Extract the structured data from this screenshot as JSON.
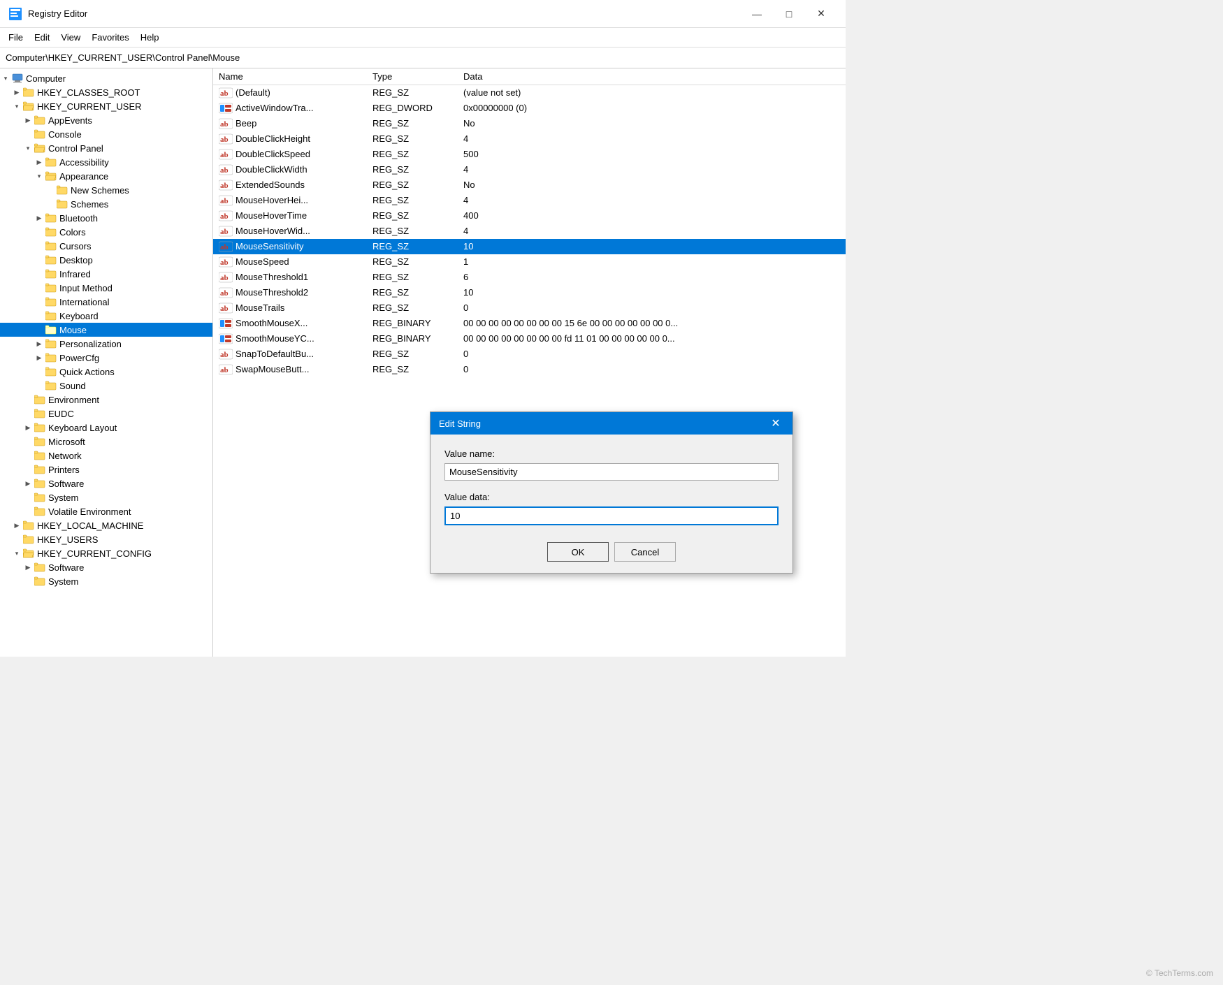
{
  "window": {
    "title": "Registry Editor",
    "icon": "registry-editor-icon"
  },
  "title_controls": {
    "minimize": "—",
    "maximize": "□",
    "close": "✕"
  },
  "menu": {
    "items": [
      "File",
      "Edit",
      "View",
      "Favorites",
      "Help"
    ]
  },
  "address_bar": {
    "path": "Computer\\HKEY_CURRENT_USER\\Control Panel\\Mouse"
  },
  "tree": {
    "items": [
      {
        "id": "computer",
        "label": "Computer",
        "indent": 0,
        "expanded": true,
        "type": "computer",
        "expander": "▾"
      },
      {
        "id": "hkey-classes-root",
        "label": "HKEY_CLASSES_ROOT",
        "indent": 1,
        "expanded": false,
        "type": "folder-closed",
        "expander": "▶"
      },
      {
        "id": "hkey-current-user",
        "label": "HKEY_CURRENT_USER",
        "indent": 1,
        "expanded": true,
        "type": "folder-open",
        "expander": "▾"
      },
      {
        "id": "app-events",
        "label": "AppEvents",
        "indent": 2,
        "expanded": false,
        "type": "folder-closed",
        "expander": "▶"
      },
      {
        "id": "console",
        "label": "Console",
        "indent": 2,
        "expanded": false,
        "type": "folder-closed",
        "expander": ""
      },
      {
        "id": "control-panel",
        "label": "Control Panel",
        "indent": 2,
        "expanded": true,
        "type": "folder-open",
        "expander": "▾"
      },
      {
        "id": "accessibility",
        "label": "Accessibility",
        "indent": 3,
        "expanded": false,
        "type": "folder-closed",
        "expander": "▶"
      },
      {
        "id": "appearance",
        "label": "Appearance",
        "indent": 3,
        "expanded": true,
        "type": "folder-open",
        "expander": "▾"
      },
      {
        "id": "new-schemes",
        "label": "New Schemes",
        "indent": 4,
        "expanded": false,
        "type": "folder-yellow",
        "expander": ""
      },
      {
        "id": "schemes",
        "label": "Schemes",
        "indent": 4,
        "expanded": false,
        "type": "folder-yellow",
        "expander": ""
      },
      {
        "id": "bluetooth",
        "label": "Bluetooth",
        "indent": 3,
        "expanded": false,
        "type": "folder-closed",
        "expander": "▶"
      },
      {
        "id": "colors",
        "label": "Colors",
        "indent": 3,
        "expanded": false,
        "type": "folder-closed",
        "expander": ""
      },
      {
        "id": "cursors",
        "label": "Cursors",
        "indent": 3,
        "expanded": false,
        "type": "folder-closed",
        "expander": ""
      },
      {
        "id": "desktop",
        "label": "Desktop",
        "indent": 3,
        "expanded": false,
        "type": "folder-closed",
        "expander": ""
      },
      {
        "id": "infrared",
        "label": "Infrared",
        "indent": 3,
        "expanded": false,
        "type": "folder-closed",
        "expander": ""
      },
      {
        "id": "input-method",
        "label": "Input Method",
        "indent": 3,
        "expanded": false,
        "type": "folder-closed",
        "expander": ""
      },
      {
        "id": "international",
        "label": "International",
        "indent": 3,
        "expanded": false,
        "type": "folder-closed",
        "expander": ""
      },
      {
        "id": "keyboard",
        "label": "Keyboard",
        "indent": 3,
        "expanded": false,
        "type": "folder-closed",
        "expander": ""
      },
      {
        "id": "mouse",
        "label": "Mouse",
        "indent": 3,
        "expanded": false,
        "type": "folder-yellow",
        "expander": "",
        "selected": true
      },
      {
        "id": "personalization",
        "label": "Personalization",
        "indent": 3,
        "expanded": false,
        "type": "folder-closed",
        "expander": "▶"
      },
      {
        "id": "powercfg",
        "label": "PowerCfg",
        "indent": 3,
        "expanded": false,
        "type": "folder-closed",
        "expander": "▶"
      },
      {
        "id": "quick-actions",
        "label": "Quick Actions",
        "indent": 3,
        "expanded": false,
        "type": "folder-closed",
        "expander": ""
      },
      {
        "id": "sound",
        "label": "Sound",
        "indent": 3,
        "expanded": false,
        "type": "folder-closed",
        "expander": ""
      },
      {
        "id": "environment",
        "label": "Environment",
        "indent": 2,
        "expanded": false,
        "type": "folder-closed",
        "expander": ""
      },
      {
        "id": "eudc",
        "label": "EUDC",
        "indent": 2,
        "expanded": false,
        "type": "folder-closed",
        "expander": ""
      },
      {
        "id": "keyboard-layout",
        "label": "Keyboard Layout",
        "indent": 2,
        "expanded": false,
        "type": "folder-closed",
        "expander": "▶"
      },
      {
        "id": "microsoft",
        "label": "Microsoft",
        "indent": 2,
        "expanded": false,
        "type": "folder-closed",
        "expander": ""
      },
      {
        "id": "network",
        "label": "Network",
        "indent": 2,
        "expanded": false,
        "type": "folder-closed",
        "expander": ""
      },
      {
        "id": "printers",
        "label": "Printers",
        "indent": 2,
        "expanded": false,
        "type": "folder-closed",
        "expander": ""
      },
      {
        "id": "software",
        "label": "Software",
        "indent": 2,
        "expanded": false,
        "type": "folder-closed",
        "expander": "▶"
      },
      {
        "id": "system",
        "label": "System",
        "indent": 2,
        "expanded": false,
        "type": "folder-closed",
        "expander": ""
      },
      {
        "id": "volatile-environment",
        "label": "Volatile Environment",
        "indent": 2,
        "expanded": false,
        "type": "folder-closed",
        "expander": ""
      },
      {
        "id": "hkey-local-machine",
        "label": "HKEY_LOCAL_MACHINE",
        "indent": 1,
        "expanded": false,
        "type": "folder-closed",
        "expander": "▶"
      },
      {
        "id": "hkey-users",
        "label": "HKEY_USERS",
        "indent": 1,
        "expanded": false,
        "type": "folder-closed",
        "expander": ""
      },
      {
        "id": "hkey-current-config",
        "label": "HKEY_CURRENT_CONFIG",
        "indent": 1,
        "expanded": true,
        "type": "folder-open",
        "expander": "▾"
      },
      {
        "id": "software-config",
        "label": "Software",
        "indent": 2,
        "expanded": false,
        "type": "folder-closed",
        "expander": "▶"
      },
      {
        "id": "system-config",
        "label": "System",
        "indent": 2,
        "expanded": false,
        "type": "folder-closed",
        "expander": ""
      }
    ]
  },
  "table": {
    "headers": {
      "name": "Name",
      "type": "Type",
      "data": "Data"
    },
    "rows": [
      {
        "icon": "ab",
        "name": "(Default)",
        "type": "REG_SZ",
        "data": "(value not set)",
        "selected": false
      },
      {
        "icon": "dword",
        "name": "ActiveWindowTra...",
        "type": "REG_DWORD",
        "data": "0x00000000 (0)",
        "selected": false
      },
      {
        "icon": "ab",
        "name": "Beep",
        "type": "REG_SZ",
        "data": "No",
        "selected": false
      },
      {
        "icon": "ab",
        "name": "DoubleClickHeight",
        "type": "REG_SZ",
        "data": "4",
        "selected": false
      },
      {
        "icon": "ab",
        "name": "DoubleClickSpeed",
        "type": "REG_SZ",
        "data": "500",
        "selected": false
      },
      {
        "icon": "ab",
        "name": "DoubleClickWidth",
        "type": "REG_SZ",
        "data": "4",
        "selected": false
      },
      {
        "icon": "ab",
        "name": "ExtendedSounds",
        "type": "REG_SZ",
        "data": "No",
        "selected": false
      },
      {
        "icon": "ab",
        "name": "MouseHoverHei...",
        "type": "REG_SZ",
        "data": "4",
        "selected": false
      },
      {
        "icon": "ab",
        "name": "MouseHoverTime",
        "type": "REG_SZ",
        "data": "400",
        "selected": false
      },
      {
        "icon": "ab",
        "name": "MouseHoverWid...",
        "type": "REG_SZ",
        "data": "4",
        "selected": false
      },
      {
        "icon": "ab",
        "name": "MouseSensitivity",
        "type": "REG_SZ",
        "data": "10",
        "selected": true
      },
      {
        "icon": "ab",
        "name": "MouseSpeed",
        "type": "REG_SZ",
        "data": "1",
        "selected": false
      },
      {
        "icon": "ab",
        "name": "MouseThreshold1",
        "type": "REG_SZ",
        "data": "6",
        "selected": false
      },
      {
        "icon": "ab",
        "name": "MouseThreshold2",
        "type": "REG_SZ",
        "data": "10",
        "selected": false
      },
      {
        "icon": "ab",
        "name": "MouseTrails",
        "type": "REG_SZ",
        "data": "0",
        "selected": false
      },
      {
        "icon": "dword",
        "name": "SmoothMouseX...",
        "type": "REG_BINARY",
        "data": "00 00 00 00 00 00 00 00 15 6e 00 00 00 00 00 00 0...",
        "selected": false
      },
      {
        "icon": "dword",
        "name": "SmoothMouseYC...",
        "type": "REG_BINARY",
        "data": "00 00 00 00 00 00 00 00 fd 11 01 00 00 00 00 00 0...",
        "selected": false
      },
      {
        "icon": "ab",
        "name": "SnapToDefaultBu...",
        "type": "REG_SZ",
        "data": "0",
        "selected": false
      },
      {
        "icon": "ab",
        "name": "SwapMouseButt...",
        "type": "REG_SZ",
        "data": "0",
        "selected": false
      }
    ]
  },
  "modal": {
    "title": "Edit String",
    "value_name_label": "Value name:",
    "value_name": "MouseSensitivity",
    "value_data_label": "Value data:",
    "value_data": "10",
    "ok_label": "OK",
    "cancel_label": "Cancel"
  },
  "watermark": "© TechTerms.com"
}
